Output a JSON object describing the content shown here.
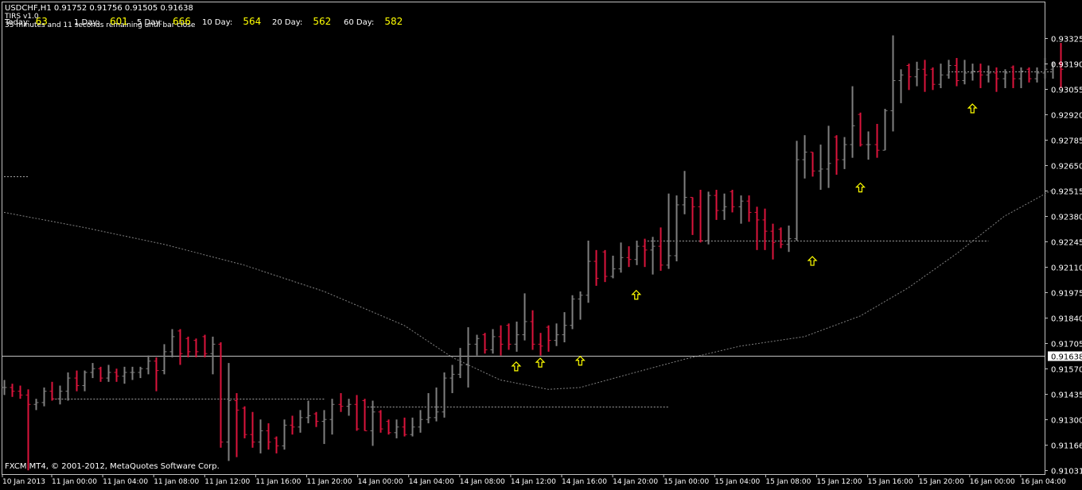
{
  "colors": {
    "background": "#000000",
    "axis": "#c0c0c0",
    "bar_up": "#808080",
    "bar_down": "#dc143c",
    "ma": "#808080",
    "arrow": "#ffff00",
    "bid_line": "#c0c0c0",
    "bid_label_bg": "#ffffff",
    "text": "#ffffff",
    "value_text": "#ffff00"
  },
  "header": {
    "title": "USDCHF,H1  0.91752 0.91756 0.91505 0.91638",
    "indicator": "TIRS v1.0",
    "remaining": "35 minutes and 11 seconds remaining until bar close",
    "copyright": "FXCM MT4, © 2001-2012, MetaQuotes Software Corp."
  },
  "ranges": [
    {
      "label": "Today:",
      "value": "63"
    },
    {
      "label": "1 Day:",
      "value": "601"
    },
    {
      "label": "5 Day:",
      "value": "666"
    },
    {
      "label": "10 Day:",
      "value": "564"
    },
    {
      "label": "20 Day:",
      "value": "562"
    },
    {
      "label": "60 Day:",
      "value": "582"
    }
  ],
  "chart_data": {
    "type": "ohlc",
    "symbol": "USDCHF",
    "timeframe": "H1",
    "current_price": "0.91638",
    "ylim": [
      0.91031,
      0.93393
    ],
    "y_ticks": [
      "0.93325",
      "0.93190",
      "0.93055",
      "0.92920",
      "0.92785",
      "0.92650",
      "0.92515",
      "0.92380",
      "0.92245",
      "0.92110",
      "0.91975",
      "0.91840",
      "0.91705",
      "0.91570",
      "0.91435",
      "0.91300",
      "0.91166",
      "0.91031"
    ],
    "x_ticks": [
      "10 Jan 2013",
      "11 Jan 00:00",
      "11 Jan 04:00",
      "11 Jan 08:00",
      "11 Jan 12:00",
      "11 Jan 16:00",
      "11 Jan 20:00",
      "14 Jan 00:00",
      "14 Jan 04:00",
      "14 Jan 08:00",
      "14 Jan 12:00",
      "14 Jan 16:00",
      "14 Jan 20:00",
      "15 Jan 00:00",
      "15 Jan 04:00",
      "15 Jan 08:00",
      "15 Jan 12:00",
      "15 Jan 16:00",
      "15 Jan 20:00",
      "16 Jan 00:00",
      "16 Jan 04:00"
    ],
    "bars": [
      {
        "o": 0.9147,
        "h": 0.9151,
        "l": 0.9143,
        "c": 0.9147
      },
      {
        "o": 0.9147,
        "h": 0.9149,
        "l": 0.9142,
        "c": 0.9145
      },
      {
        "o": 0.9145,
        "h": 0.9148,
        "l": 0.9141,
        "c": 0.9143
      },
      {
        "o": 0.9143,
        "h": 0.9146,
        "l": 0.9103,
        "c": 0.9138
      },
      {
        "o": 0.9138,
        "h": 0.9141,
        "l": 0.9135,
        "c": 0.9139
      },
      {
        "o": 0.9139,
        "h": 0.9147,
        "l": 0.9137,
        "c": 0.9145
      },
      {
        "o": 0.9145,
        "h": 0.915,
        "l": 0.914,
        "c": 0.9141
      },
      {
        "o": 0.9141,
        "h": 0.9148,
        "l": 0.9138,
        "c": 0.9145
      },
      {
        "o": 0.9145,
        "h": 0.9155,
        "l": 0.914,
        "c": 0.9152
      },
      {
        "o": 0.9152,
        "h": 0.9156,
        "l": 0.9145,
        "c": 0.9148
      },
      {
        "o": 0.9148,
        "h": 0.9156,
        "l": 0.9145,
        "c": 0.9155
      },
      {
        "o": 0.9155,
        "h": 0.916,
        "l": 0.9152,
        "c": 0.9157
      },
      {
        "o": 0.9157,
        "h": 0.9158,
        "l": 0.915,
        "c": 0.9152
      },
      {
        "o": 0.9152,
        "h": 0.9159,
        "l": 0.915,
        "c": 0.9155
      },
      {
        "o": 0.9155,
        "h": 0.9157,
        "l": 0.915,
        "c": 0.9153
      },
      {
        "o": 0.9153,
        "h": 0.9158,
        "l": 0.9149,
        "c": 0.9155
      },
      {
        "o": 0.9155,
        "h": 0.9158,
        "l": 0.9151,
        "c": 0.9155
      },
      {
        "o": 0.9155,
        "h": 0.9158,
        "l": 0.9152,
        "c": 0.9157
      },
      {
        "o": 0.9157,
        "h": 0.9164,
        "l": 0.9154,
        "c": 0.9161
      },
      {
        "o": 0.9161,
        "h": 0.9163,
        "l": 0.9145,
        "c": 0.9156
      },
      {
        "o": 0.9156,
        "h": 0.917,
        "l": 0.9154,
        "c": 0.9166
      },
      {
        "o": 0.9166,
        "h": 0.9178,
        "l": 0.9163,
        "c": 0.9174
      },
      {
        "o": 0.9177,
        "h": 0.9178,
        "l": 0.9159,
        "c": 0.9165
      },
      {
        "o": 0.9173,
        "h": 0.9174,
        "l": 0.9163,
        "c": 0.9166
      },
      {
        "o": 0.9172,
        "h": 0.9173,
        "l": 0.9163,
        "c": 0.9166
      },
      {
        "o": 0.9174,
        "h": 0.9175,
        "l": 0.9163,
        "c": 0.9165
      },
      {
        "o": 0.9165,
        "h": 0.9174,
        "l": 0.9154,
        "c": 0.917
      },
      {
        "o": 0.917,
        "h": 0.9171,
        "l": 0.9115,
        "c": 0.9118
      },
      {
        "o": 0.9118,
        "h": 0.916,
        "l": 0.9108,
        "c": 0.914
      },
      {
        "o": 0.914,
        "h": 0.9144,
        "l": 0.911,
        "c": 0.9135
      },
      {
        "o": 0.9136,
        "h": 0.9137,
        "l": 0.912,
        "c": 0.9122
      },
      {
        "o": 0.9122,
        "h": 0.9134,
        "l": 0.9115,
        "c": 0.9118
      },
      {
        "o": 0.9118,
        "h": 0.913,
        "l": 0.9112,
        "c": 0.9124
      },
      {
        "o": 0.9124,
        "h": 0.9128,
        "l": 0.9114,
        "c": 0.9118
      },
      {
        "o": 0.912,
        "h": 0.9121,
        "l": 0.9112,
        "c": 0.9116
      },
      {
        "o": 0.9116,
        "h": 0.913,
        "l": 0.9114,
        "c": 0.9127
      },
      {
        "o": 0.9127,
        "h": 0.9132,
        "l": 0.9122,
        "c": 0.9126
      },
      {
        "o": 0.9126,
        "h": 0.9135,
        "l": 0.9123,
        "c": 0.9131
      },
      {
        "o": 0.9131,
        "h": 0.914,
        "l": 0.9128,
        "c": 0.9132
      },
      {
        "o": 0.9133,
        "h": 0.9134,
        "l": 0.9126,
        "c": 0.9129
      },
      {
        "o": 0.9129,
        "h": 0.9135,
        "l": 0.9117,
        "c": 0.913
      },
      {
        "o": 0.913,
        "h": 0.9141,
        "l": 0.9122,
        "c": 0.9138
      },
      {
        "o": 0.9138,
        "h": 0.9144,
        "l": 0.9134,
        "c": 0.9137
      },
      {
        "o": 0.9137,
        "h": 0.9141,
        "l": 0.9132,
        "c": 0.9138
      },
      {
        "o": 0.9138,
        "h": 0.9143,
        "l": 0.9124,
        "c": 0.9125
      },
      {
        "o": 0.914,
        "h": 0.9141,
        "l": 0.9124,
        "c": 0.9124
      },
      {
        "o": 0.9124,
        "h": 0.914,
        "l": 0.9116,
        "c": 0.9134
      },
      {
        "o": 0.9134,
        "h": 0.9135,
        "l": 0.9123,
        "c": 0.9125
      },
      {
        "o": 0.9129,
        "h": 0.913,
        "l": 0.9122,
        "c": 0.9123
      },
      {
        "o": 0.9123,
        "h": 0.913,
        "l": 0.912,
        "c": 0.9126
      },
      {
        "o": 0.9126,
        "h": 0.9131,
        "l": 0.9121,
        "c": 0.9122
      },
      {
        "o": 0.9122,
        "h": 0.9131,
        "l": 0.9121,
        "c": 0.9126
      },
      {
        "o": 0.9126,
        "h": 0.9135,
        "l": 0.9123,
        "c": 0.913
      },
      {
        "o": 0.913,
        "h": 0.9144,
        "l": 0.9128,
        "c": 0.9131
      },
      {
        "o": 0.9131,
        "h": 0.9147,
        "l": 0.9129,
        "c": 0.9134
      },
      {
        "o": 0.9134,
        "h": 0.9155,
        "l": 0.9131,
        "c": 0.9152
      },
      {
        "o": 0.9152,
        "h": 0.9159,
        "l": 0.9144,
        "c": 0.9154
      },
      {
        "o": 0.9154,
        "h": 0.9168,
        "l": 0.9152,
        "c": 0.9159
      },
      {
        "o": 0.9159,
        "h": 0.9179,
        "l": 0.9147,
        "c": 0.917
      },
      {
        "o": 0.917,
        "h": 0.9175,
        "l": 0.9164,
        "c": 0.9173
      },
      {
        "o": 0.9175,
        "h": 0.9176,
        "l": 0.9165,
        "c": 0.9167
      },
      {
        "o": 0.9167,
        "h": 0.9178,
        "l": 0.9165,
        "c": 0.9174
      },
      {
        "o": 0.9174,
        "h": 0.918,
        "l": 0.9164,
        "c": 0.917
      },
      {
        "o": 0.918,
        "h": 0.9181,
        "l": 0.9167,
        "c": 0.917
      },
      {
        "o": 0.917,
        "h": 0.9182,
        "l": 0.9166,
        "c": 0.9175
      },
      {
        "o": 0.9175,
        "h": 0.9197,
        "l": 0.9172,
        "c": 0.9182
      },
      {
        "o": 0.9182,
        "h": 0.9188,
        "l": 0.9167,
        "c": 0.917
      },
      {
        "o": 0.917,
        "h": 0.9176,
        "l": 0.9164,
        "c": 0.9169
      },
      {
        "o": 0.9179,
        "h": 0.918,
        "l": 0.9166,
        "c": 0.9172
      },
      {
        "o": 0.9172,
        "h": 0.9181,
        "l": 0.9169,
        "c": 0.9175
      },
      {
        "o": 0.9175,
        "h": 0.9187,
        "l": 0.9171,
        "c": 0.918
      },
      {
        "o": 0.918,
        "h": 0.9196,
        "l": 0.9178,
        "c": 0.9194
      },
      {
        "o": 0.9194,
        "h": 0.9198,
        "l": 0.9183,
        "c": 0.9196
      },
      {
        "o": 0.9196,
        "h": 0.9225,
        "l": 0.9192,
        "c": 0.9214
      },
      {
        "o": 0.9214,
        "h": 0.922,
        "l": 0.9201,
        "c": 0.9205
      },
      {
        "o": 0.9219,
        "h": 0.922,
        "l": 0.9203,
        "c": 0.9206
      },
      {
        "o": 0.9206,
        "h": 0.9217,
        "l": 0.9205,
        "c": 0.921
      },
      {
        "o": 0.921,
        "h": 0.9224,
        "l": 0.9208,
        "c": 0.9216
      },
      {
        "o": 0.9216,
        "h": 0.9222,
        "l": 0.9211,
        "c": 0.9215
      },
      {
        "o": 0.9215,
        "h": 0.9225,
        "l": 0.9212,
        "c": 0.9222
      },
      {
        "o": 0.9222,
        "h": 0.9226,
        "l": 0.9211,
        "c": 0.922
      },
      {
        "o": 0.922,
        "h": 0.9227,
        "l": 0.9207,
        "c": 0.9222
      },
      {
        "o": 0.9222,
        "h": 0.9232,
        "l": 0.9209,
        "c": 0.9212
      },
      {
        "o": 0.9212,
        "h": 0.925,
        "l": 0.921,
        "c": 0.9217
      },
      {
        "o": 0.9217,
        "h": 0.9249,
        "l": 0.9214,
        "c": 0.9244
      },
      {
        "o": 0.9244,
        "h": 0.9262,
        "l": 0.9239,
        "c": 0.9248
      },
      {
        "o": 0.9248,
        "h": 0.9248,
        "l": 0.9228,
        "c": 0.9243
      },
      {
        "o": 0.9243,
        "h": 0.9252,
        "l": 0.9224,
        "c": 0.9225
      },
      {
        "o": 0.9225,
        "h": 0.9251,
        "l": 0.9223,
        "c": 0.9249
      },
      {
        "o": 0.9249,
        "h": 0.9252,
        "l": 0.9236,
        "c": 0.9241
      },
      {
        "o": 0.9241,
        "h": 0.925,
        "l": 0.9236,
        "c": 0.9243
      },
      {
        "o": 0.9251,
        "h": 0.9252,
        "l": 0.924,
        "c": 0.9243
      },
      {
        "o": 0.9243,
        "h": 0.9249,
        "l": 0.9234,
        "c": 0.9246
      },
      {
        "o": 0.9246,
        "h": 0.9249,
        "l": 0.9235,
        "c": 0.924
      },
      {
        "o": 0.924,
        "h": 0.9243,
        "l": 0.922,
        "c": 0.9236
      },
      {
        "o": 0.9236,
        "h": 0.9242,
        "l": 0.922,
        "c": 0.923
      },
      {
        "o": 0.923,
        "h": 0.9234,
        "l": 0.9215,
        "c": 0.9224
      },
      {
        "o": 0.9231,
        "h": 0.9232,
        "l": 0.9221,
        "c": 0.9223
      },
      {
        "o": 0.9223,
        "h": 0.9233,
        "l": 0.9219,
        "c": 0.9226
      },
      {
        "o": 0.9226,
        "h": 0.9278,
        "l": 0.9225,
        "c": 0.9268
      },
      {
        "o": 0.9268,
        "h": 0.9281,
        "l": 0.9258,
        "c": 0.9272
      },
      {
        "o": 0.9272,
        "h": 0.9272,
        "l": 0.9259,
        "c": 0.9262
      },
      {
        "o": 0.9262,
        "h": 0.9276,
        "l": 0.9252,
        "c": 0.9263
      },
      {
        "o": 0.9263,
        "h": 0.9286,
        "l": 0.9253,
        "c": 0.9266
      },
      {
        "o": 0.928,
        "h": 0.9281,
        "l": 0.926,
        "c": 0.9268
      },
      {
        "o": 0.9268,
        "h": 0.928,
        "l": 0.9263,
        "c": 0.9276
      },
      {
        "o": 0.9276,
        "h": 0.9307,
        "l": 0.9269,
        "c": 0.9286
      },
      {
        "o": 0.9292,
        "h": 0.9293,
        "l": 0.9275,
        "c": 0.9276
      },
      {
        "o": 0.9276,
        "h": 0.9283,
        "l": 0.9268,
        "c": 0.9276
      },
      {
        "o": 0.9276,
        "h": 0.9287,
        "l": 0.9269,
        "c": 0.9273
      },
      {
        "o": 0.9273,
        "h": 0.9295,
        "l": 0.9273,
        "c": 0.9294
      },
      {
        "o": 0.9294,
        "h": 0.9334,
        "l": 0.9283,
        "c": 0.931
      },
      {
        "o": 0.931,
        "h": 0.9316,
        "l": 0.9298,
        "c": 0.9313
      },
      {
        "o": 0.9318,
        "h": 0.9319,
        "l": 0.9305,
        "c": 0.9312
      },
      {
        "o": 0.9312,
        "h": 0.932,
        "l": 0.9307,
        "c": 0.9316
      },
      {
        "o": 0.9316,
        "h": 0.9321,
        "l": 0.9304,
        "c": 0.9313
      },
      {
        "o": 0.9316,
        "h": 0.9317,
        "l": 0.9305,
        "c": 0.9308
      },
      {
        "o": 0.9308,
        "h": 0.9319,
        "l": 0.9306,
        "c": 0.9313
      },
      {
        "o": 0.9313,
        "h": 0.9321,
        "l": 0.9311,
        "c": 0.9318
      },
      {
        "o": 0.9318,
        "h": 0.9322,
        "l": 0.9307,
        "c": 0.931
      },
      {
        "o": 0.931,
        "h": 0.9321,
        "l": 0.9308,
        "c": 0.9314
      },
      {
        "o": 0.9314,
        "h": 0.9319,
        "l": 0.931,
        "c": 0.9315
      },
      {
        "o": 0.9315,
        "h": 0.9319,
        "l": 0.9306,
        "c": 0.9313
      },
      {
        "o": 0.9313,
        "h": 0.9318,
        "l": 0.9309,
        "c": 0.9314
      },
      {
        "o": 0.9314,
        "h": 0.9317,
        "l": 0.9304,
        "c": 0.9311
      },
      {
        "o": 0.9311,
        "h": 0.9316,
        "l": 0.9306,
        "c": 0.9314
      },
      {
        "o": 0.9317,
        "h": 0.9318,
        "l": 0.9306,
        "c": 0.9311
      },
      {
        "o": 0.9311,
        "h": 0.9317,
        "l": 0.9306,
        "c": 0.9315
      },
      {
        "o": 0.9316,
        "h": 0.9317,
        "l": 0.9309,
        "c": 0.9311
      },
      {
        "o": 0.9311,
        "h": 0.9317,
        "l": 0.9309,
        "c": 0.9314
      },
      {
        "o": 0.9314,
        "h": 0.9322,
        "l": 0.9311,
        "c": 0.9316
      },
      {
        "o": 0.9316,
        "h": 0.932,
        "l": 0.9311,
        "c": 0.9319
      },
      {
        "o": 0.9319,
        "h": 0.933,
        "l": 0.9306,
        "c": 0.9316
      }
    ],
    "moving_average": [
      {
        "bar": 0,
        "v": 0.924
      },
      {
        "bar": 10,
        "v": 0.9232
      },
      {
        "bar": 20,
        "v": 0.9223
      },
      {
        "bar": 30,
        "v": 0.9212
      },
      {
        "bar": 40,
        "v": 0.9198
      },
      {
        "bar": 50,
        "v": 0.918
      },
      {
        "bar": 56,
        "v": 0.9163
      },
      {
        "bar": 62,
        "v": 0.9151
      },
      {
        "bar": 68,
        "v": 0.9146
      },
      {
        "bar": 72,
        "v": 0.9147
      },
      {
        "bar": 78,
        "v": 0.9154
      },
      {
        "bar": 85,
        "v": 0.9162
      },
      {
        "bar": 92,
        "v": 0.9169
      },
      {
        "bar": 100,
        "v": 0.9174
      },
      {
        "bar": 107,
        "v": 0.9185
      },
      {
        "bar": 113,
        "v": 0.92
      },
      {
        "bar": 119,
        "v": 0.9218
      },
      {
        "bar": 125,
        "v": 0.9238
      },
      {
        "bar": 131,
        "v": 0.9252
      }
    ],
    "levels": [
      {
        "from": 0,
        "to": 3,
        "v": 0.9259
      },
      {
        "from": 6,
        "to": 40,
        "v": 0.9141
      },
      {
        "from": 45,
        "to": 83,
        "v": 0.9137
      },
      {
        "from": 80,
        "to": 123,
        "v": 0.9225
      },
      {
        "from": 118,
        "to": 131,
        "v": 0.9315
      }
    ],
    "arrows": [
      {
        "bar": 64,
        "v": 0.9158
      },
      {
        "bar": 67,
        "v": 0.916
      },
      {
        "bar": 72,
        "v": 0.9161
      },
      {
        "bar": 79,
        "v": 0.9196
      },
      {
        "bar": 101,
        "v": 0.9214
      },
      {
        "bar": 107,
        "v": 0.9253
      },
      {
        "bar": 121,
        "v": 0.9295
      }
    ]
  }
}
